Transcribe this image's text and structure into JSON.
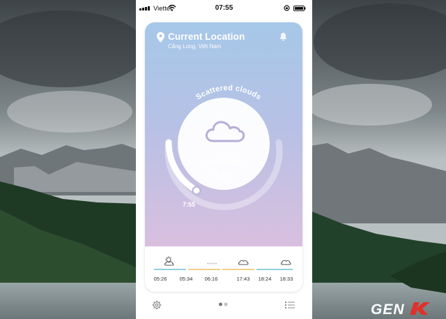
{
  "status_bar": {
    "carrier": "Viettel",
    "time": "07:55",
    "icons": [
      "signal-icon",
      "wifi-icon",
      "rotation-lock-icon",
      "battery-icon"
    ]
  },
  "location": {
    "title": "Current Location",
    "subtitle": "Căng Long, Việt Nam",
    "icon": "location-pin-icon",
    "notify_icon": "bell-icon"
  },
  "weather": {
    "condition": "Scattered clouds",
    "wind": "16Km/h",
    "temperature": "26°",
    "sunrise_time": "7:55",
    "icons": [
      "cloud-icon",
      "wind-icon",
      "thermometer-icon"
    ]
  },
  "forecast": {
    "items": [
      {
        "time": "05:26",
        "icon": "sun-cloud-icon",
        "bar_color": "#8fd0dc"
      },
      {
        "time": "05:34",
        "icon": "none",
        "bar_color": "#f0cf86"
      },
      {
        "time": "06:16",
        "icon": "dots",
        "bar_color": "#f0cf86"
      },
      {
        "time": "17:43",
        "icon": "cloud-icon",
        "bar_color": "#f0cf86"
      },
      {
        "time": "18:24",
        "icon": "none",
        "bar_color": "#8fd0dc"
      },
      {
        "time": "18:33",
        "icon": "cloud-icon",
        "bar_color": "#8fd0dc"
      }
    ]
  },
  "bottom_nav": {
    "left_icon": "settings-gear-icon",
    "center": "page-indicator",
    "right_icon": "list-icon"
  },
  "watermark": "GENK",
  "colors": {
    "gradient_top": "#a6c8e8",
    "gradient_bottom": "#d9bfdf",
    "bar_blue": "#8fd0dc",
    "bar_yellow": "#f0cf86",
    "cloud_stroke": "#b6aed6"
  }
}
